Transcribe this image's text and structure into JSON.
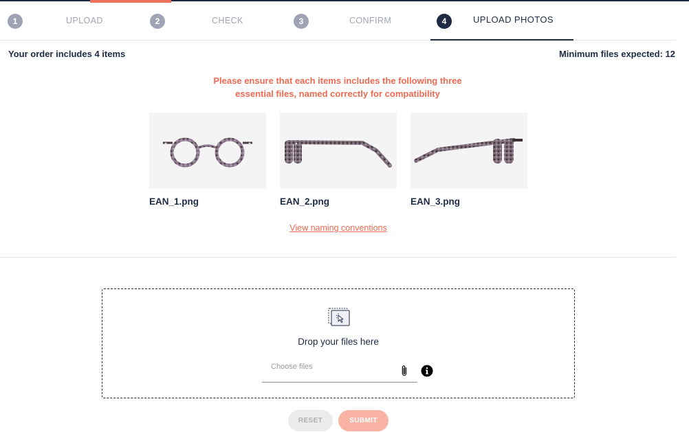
{
  "stepper": {
    "steps": [
      {
        "number": "1",
        "label": "UPLOAD"
      },
      {
        "number": "2",
        "label": "CHECK"
      },
      {
        "number": "3",
        "label": "CONFIRM"
      },
      {
        "number": "4",
        "label": "UPLOAD PHOTOS"
      }
    ],
    "active_step": 4
  },
  "summary": {
    "order_text": "Your order includes 4 items",
    "min_files_text": "Minimum files expected: 12"
  },
  "notice": {
    "line1": "Please ensure that each items includes the following three",
    "line2": "essential files, named correctly for compatibility"
  },
  "examples": [
    {
      "filename": "EAN_1.png",
      "view": "front"
    },
    {
      "filename": "EAN_2.png",
      "view": "side"
    },
    {
      "filename": "EAN_3.png",
      "view": "three-quarter"
    }
  ],
  "naming_link": "View naming conventions",
  "dropzone": {
    "text": "Drop your files here",
    "placeholder": "Choose files"
  },
  "buttons": {
    "reset": "RESET",
    "submit": "SUBMIT"
  },
  "colors": {
    "accent": "#ee6a52",
    "navy": "#1f2a44",
    "step_inactive": "#9fa3b4",
    "submit_disabled": "#f8b3a5"
  },
  "icons": {
    "dropzone": "drag-drop-cursor-icon",
    "attach": "paperclip-icon",
    "info": "info-icon"
  }
}
